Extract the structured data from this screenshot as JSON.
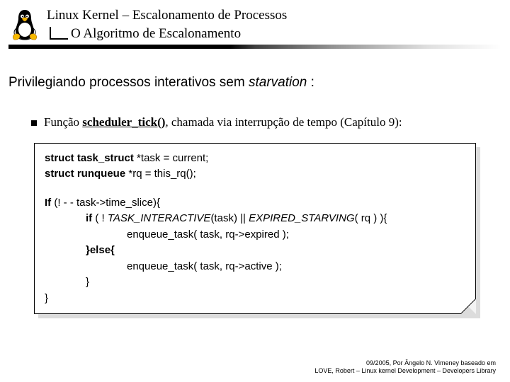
{
  "header": {
    "title": "Linux Kernel – Escalonamento de Processos",
    "subtitle": "O Algoritmo de Escalonamento"
  },
  "section": {
    "heading_plain": "Privilegiando processos interativos sem ",
    "heading_italic": "starvation",
    "heading_tail": " :"
  },
  "bullet": {
    "prefix": "Função ",
    "fn": "scheduler_tick()",
    "rest": ", chamada via interrupção de tempo (Capítulo 9):"
  },
  "code": {
    "l1_bold": "struct task_struct",
    "l1_rest": " *task = current;",
    "l2_bold": "struct runqueue",
    "l2_rest": " *rq = this_rq();",
    "l3_bold": "If",
    "l3_rest": " (! - - task->time_slice){",
    "l4_bold": "if",
    "l4_mid": " ( ! ",
    "l4_it1": "TASK_INTERACTIVE",
    "l4_mid2": "(task) || ",
    "l4_it2": "EXPIRED_STARVING",
    "l4_rest": "( rq ) ){",
    "l5": "enqueue_task( task, rq->expired );",
    "l6": "}else{",
    "l7": "enqueue_task( task, rq->active );",
    "l8": "}",
    "l9": "}"
  },
  "footer": {
    "line1": "09/2005, Por Ângelo N. Vimeney baseado em",
    "line2": "LOVE, Robert – Linux kernel Development – Developers Library"
  }
}
